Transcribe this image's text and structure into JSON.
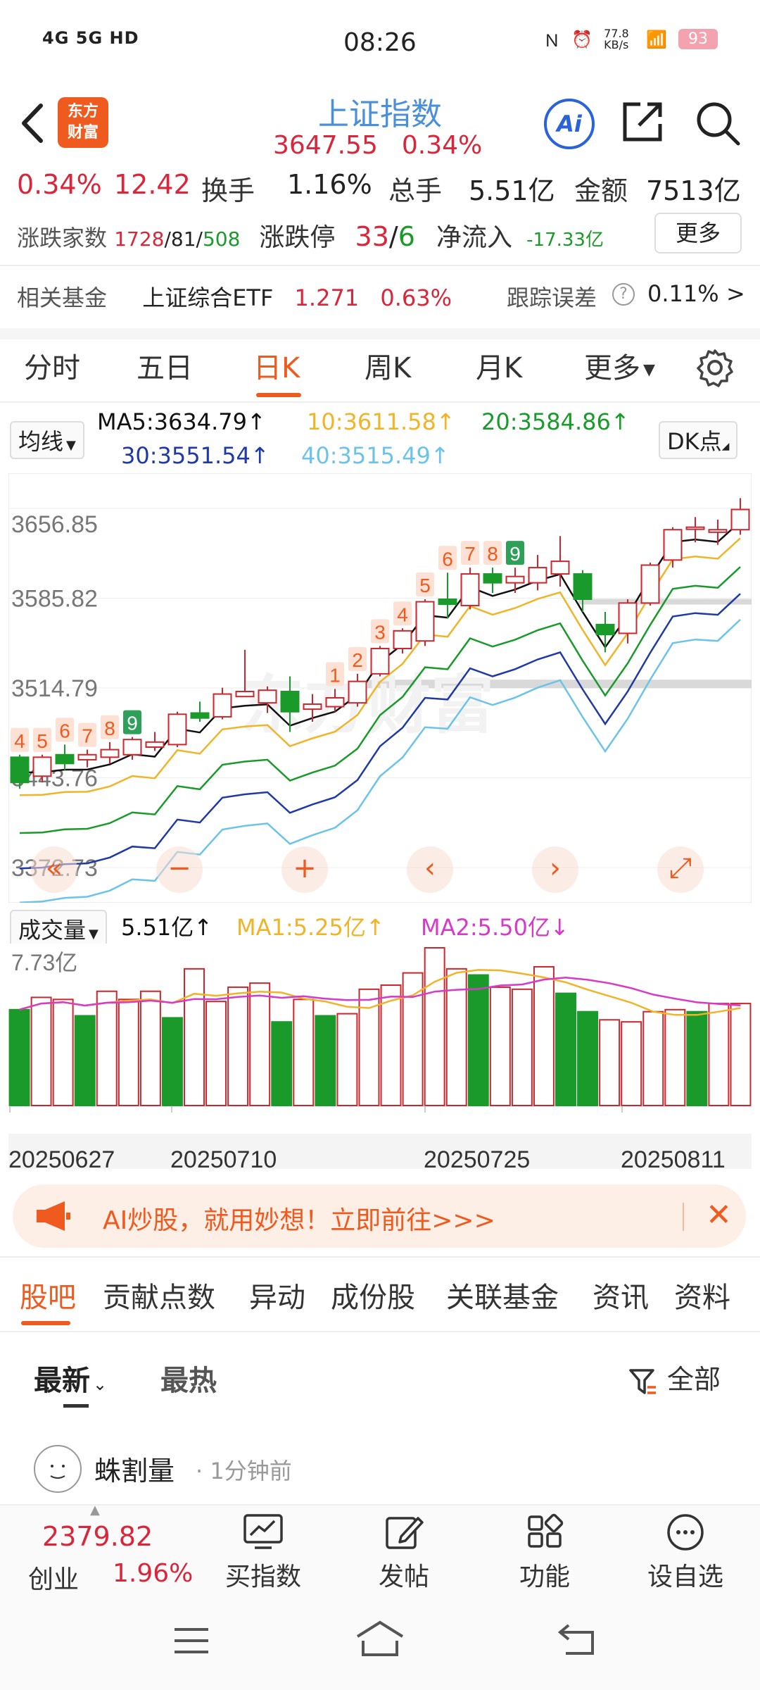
{
  "status_bar": {
    "time": "08:26",
    "left_icons": "4G 5G HD",
    "network_speed": "77.8 KB/s",
    "battery": "93"
  },
  "header": {
    "logo_line1": "东方",
    "logo_line2": "财富",
    "title": "上证指数",
    "price": "3647.55",
    "change_pct": "0.34%",
    "ai_label": "Ai"
  },
  "stats": {
    "pct": "0.34%",
    "change": "12.42",
    "turnover_label": "换手",
    "turnover": "1.16%",
    "volume_label": "总手",
    "volume": "5.51亿",
    "amount_label": "金额",
    "amount": "7513亿",
    "breadth_label": "涨跌家数",
    "up_count": "1728",
    "flat_count": "81",
    "down_count": "508",
    "limit_label": "涨跌停",
    "limit_up": "33",
    "limit_down": "6",
    "netflow_label": "净流入",
    "netflow": "-17.33亿",
    "more_button": "更多"
  },
  "fund_row": {
    "label": "相关基金",
    "fund_name": "上证综合ETF",
    "fund_price": "1.271",
    "fund_pct": "0.63%",
    "tracking_label": "跟踪误差",
    "tracking_value": "0.11%",
    "arrow": ">"
  },
  "period_tabs": [
    "分时",
    "五日",
    "日K",
    "周K",
    "月K",
    "更多"
  ],
  "ma_legend": {
    "selector": "均线",
    "ma5": "MA5:3634.79↑",
    "ma10": "10:3611.58↑",
    "ma20": "20:3584.86↑",
    "ma30": "30:3551.54↑",
    "ma40": "40:3515.49↑",
    "dk_button": "DK点",
    "colors": {
      "ma5": "#111111",
      "ma10": "#f0b429",
      "ma20": "#1a9a2a",
      "ma30": "#1f3aa6",
      "ma40": "#6cc3ea"
    }
  },
  "chart_data": [
    {
      "type": "candlestick",
      "ylim": [
        3372.73,
        3656.85
      ],
      "y_ticks": [
        "3656.85",
        "3585.82",
        "3514.79",
        "3443.76",
        "3372.73"
      ],
      "candles": [
        {
          "o": 3440,
          "c": 3460,
          "h": 3462,
          "l": 3435,
          "up": false
        },
        {
          "o": 3445,
          "c": 3460,
          "h": 3462,
          "l": 3440,
          "up": true
        },
        {
          "o": 3455,
          "c": 3462,
          "h": 3470,
          "l": 3450,
          "up": false
        },
        {
          "o": 3458,
          "c": 3462,
          "h": 3466,
          "l": 3452,
          "up": true
        },
        {
          "o": 3460,
          "c": 3466,
          "h": 3472,
          "l": 3455,
          "up": true
        },
        {
          "o": 3462,
          "c": 3474,
          "h": 3476,
          "l": 3458,
          "up": true
        },
        {
          "o": 3468,
          "c": 3472,
          "h": 3480,
          "l": 3465,
          "up": true
        },
        {
          "o": 3470,
          "c": 3494,
          "h": 3496,
          "l": 3468,
          "up": true
        },
        {
          "o": 3495,
          "c": 3491,
          "h": 3504,
          "l": 3488,
          "up": false
        },
        {
          "o": 3492,
          "c": 3510,
          "h": 3515,
          "l": 3490,
          "up": true
        },
        {
          "o": 3508,
          "c": 3512,
          "h": 3545,
          "l": 3508,
          "up": true
        },
        {
          "o": 3503,
          "c": 3513,
          "h": 3516,
          "l": 3495,
          "up": true
        },
        {
          "o": 3512,
          "c": 3496,
          "h": 3524,
          "l": 3480,
          "up": false
        },
        {
          "o": 3498,
          "c": 3502,
          "h": 3510,
          "l": 3488,
          "up": true
        },
        {
          "o": 3500,
          "c": 3507,
          "h": 3514,
          "l": 3496,
          "up": true
        },
        {
          "o": 3503,
          "c": 3520,
          "h": 3526,
          "l": 3500,
          "up": true
        },
        {
          "o": 3526,
          "c": 3546,
          "h": 3548,
          "l": 3524,
          "up": true
        },
        {
          "o": 3546,
          "c": 3560,
          "h": 3562,
          "l": 3542,
          "up": true
        },
        {
          "o": 3552,
          "c": 3583,
          "h": 3585,
          "l": 3548,
          "up": true
        },
        {
          "o": 3585,
          "c": 3581,
          "h": 3606,
          "l": 3570,
          "up": false
        },
        {
          "o": 3580,
          "c": 3605,
          "h": 3610,
          "l": 3577,
          "up": true
        },
        {
          "o": 3605,
          "c": 3598,
          "h": 3610,
          "l": 3590,
          "up": false
        },
        {
          "o": 3598,
          "c": 3603,
          "h": 3610,
          "l": 3590,
          "up": true
        },
        {
          "o": 3598,
          "c": 3610,
          "h": 3620,
          "l": 3592,
          "up": true
        },
        {
          "o": 3605,
          "c": 3615,
          "h": 3635,
          "l": 3595,
          "up": true
        },
        {
          "o": 3605,
          "c": 3585,
          "h": 3608,
          "l": 3575,
          "up": false
        },
        {
          "o": 3565,
          "c": 3557,
          "h": 3575,
          "l": 3543,
          "up": false
        },
        {
          "o": 3558,
          "c": 3582,
          "h": 3585,
          "l": 3550,
          "up": true
        },
        {
          "o": 3582,
          "c": 3612,
          "h": 3614,
          "l": 3580,
          "up": true
        },
        {
          "o": 3616,
          "c": 3640,
          "h": 3642,
          "l": 3610,
          "up": true
        },
        {
          "o": 3641,
          "c": 3642,
          "h": 3650,
          "l": 3630,
          "up": true
        },
        {
          "o": 3638,
          "c": 3640,
          "h": 3648,
          "l": 3628,
          "up": true
        },
        {
          "o": 3640,
          "c": 3656,
          "h": 3665,
          "l": 3636,
          "up": true
        }
      ],
      "td_labels": [
        {
          "i": 0,
          "t": "4"
        },
        {
          "i": 1,
          "t": "5"
        },
        {
          "i": 2,
          "t": "6"
        },
        {
          "i": 3,
          "t": "7"
        },
        {
          "i": 4,
          "t": "8"
        },
        {
          "i": 5,
          "t": "9",
          "green": true
        },
        {
          "i": 14,
          "t": "1"
        },
        {
          "i": 15,
          "t": "2"
        },
        {
          "i": 16,
          "t": "3"
        },
        {
          "i": 17,
          "t": "4"
        },
        {
          "i": 18,
          "t": "5"
        },
        {
          "i": 19,
          "t": "6"
        },
        {
          "i": 20,
          "t": "7"
        },
        {
          "i": 21,
          "t": "8"
        },
        {
          "i": 22,
          "t": "9",
          "green": true
        }
      ]
    },
    {
      "type": "bar",
      "title": "成交量",
      "ylim": [
        0,
        7.73
      ],
      "y_tick": "7.73亿",
      "values": [
        4.7,
        5.3,
        5.2,
        4.4,
        5.6,
        5.2,
        5.6,
        4.3,
        6.7,
        5.1,
        5.8,
        6.0,
        4.1,
        5.2,
        4.4,
        4.5,
        5.7,
        5.9,
        6.5,
        7.73,
        6.7,
        6.4,
        5.8,
        5.7,
        6.8,
        5.5,
        4.6,
        4.2,
        4.1,
        4.6,
        4.7,
        4.6,
        5.0,
        5.0
      ],
      "series_up": [
        false,
        true,
        true,
        false,
        true,
        true,
        true,
        false,
        true,
        true,
        true,
        true,
        false,
        true,
        false,
        true,
        true,
        true,
        true,
        true,
        true,
        false,
        true,
        true,
        true,
        false,
        false,
        true,
        true,
        true,
        true,
        false,
        true,
        true
      ],
      "x_labels": [
        "20250627",
        "20250710",
        "20250725",
        "20250811"
      ]
    }
  ],
  "volume_legend": {
    "selector": "成交量",
    "current": "5.51亿↑",
    "ma1": "MA1:5.25亿↑",
    "ma2": "MA2:5.50亿↓",
    "y_tick": "7.73亿"
  },
  "banner": {
    "text": "AI炒股，就用妙想！立即前往>>>"
  },
  "bottom_tabs": [
    "股吧",
    "贡献点数",
    "异动",
    "成份股",
    "关联基金",
    "资讯",
    "资料"
  ],
  "sort": {
    "latest": "最新",
    "hottest": "最热",
    "filter": "全部"
  },
  "post": {
    "author": "蛛割量",
    "time": "· 1分钟前"
  },
  "bottom_bar": {
    "price": "2379.82",
    "name": "创业",
    "pct": "1.96%",
    "items": [
      "买指数",
      "发帖",
      "功能",
      "设自选"
    ]
  }
}
